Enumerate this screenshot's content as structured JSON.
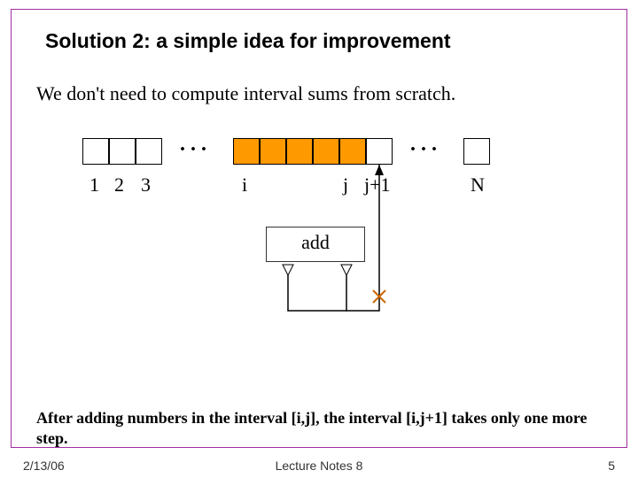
{
  "title": "Solution 2:  a simple idea for improvement",
  "intro": "We don't need to compute interval sums from scratch.",
  "labels": {
    "l1": "1",
    "l2": "2",
    "l3": "3",
    "i": "i",
    "j": "j",
    "jp1": "j+1",
    "N": "N",
    "dots": ". . .",
    "add": "add"
  },
  "conclusion": "After adding numbers in the interval [i,j], the interval [i,j+1] takes only one more step.",
  "footer": {
    "date": "2/13/06",
    "center": "Lecture Notes 8",
    "page": "5"
  }
}
